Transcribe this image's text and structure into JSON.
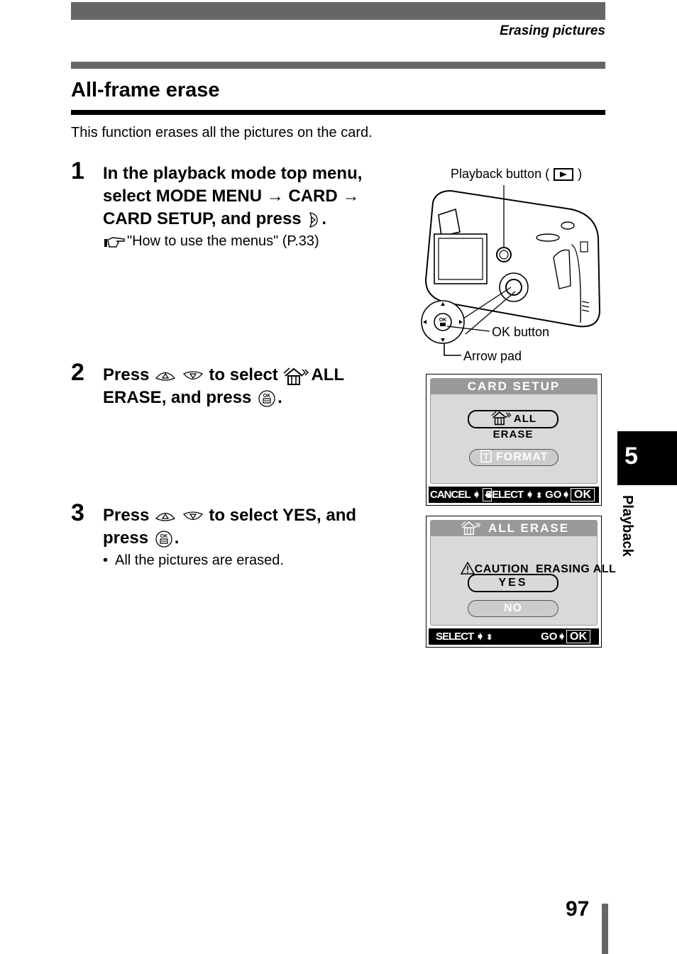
{
  "header": {
    "section_title": "Erasing pictures"
  },
  "page": {
    "title": "All-frame erase",
    "intro": "This function erases all the pictures on the card.",
    "number": "97"
  },
  "chapter_tab": {
    "number": "5",
    "label": "Playback"
  },
  "steps": [
    {
      "number": "1",
      "lines": [
        "In the playback mode top menu,",
        "select MODE MENU → CARD →",
        "CARD SETUP, and press"
      ],
      "end": ".",
      "reference": "\"How to use the menus\" (P.33)"
    },
    {
      "number": "2",
      "part1": "Press",
      "part2": "to select",
      "part3": "ALL",
      "line2": "ERASE, and press",
      "end": "."
    },
    {
      "number": "3",
      "part1": "Press",
      "part2": "to select YES, and",
      "line2": "press",
      "end": ".",
      "bullet": "All the pictures are erased."
    }
  ],
  "camera_figure": {
    "playback_label": "Playback button (",
    "playback_close": ")",
    "ok_label": "OK button",
    "arrow_label": "Arrow pad",
    "ok_text": "OK"
  },
  "screen_card_setup": {
    "title": "CARD SETUP",
    "options": [
      "ALL ERASE",
      "FORMAT"
    ],
    "selected": "ALL ERASE",
    "footer": {
      "cancel": "CANCEL",
      "select": "SELECT",
      "go": "GO",
      "ok": "OK"
    }
  },
  "screen_all_erase": {
    "title": "ALL ERASE",
    "caution": "CAUTION  ERASING ALL",
    "options": [
      "YES",
      "NO"
    ],
    "selected": "YES",
    "footer": {
      "select": "SELECT",
      "go": "GO",
      "ok": "OK"
    }
  }
}
